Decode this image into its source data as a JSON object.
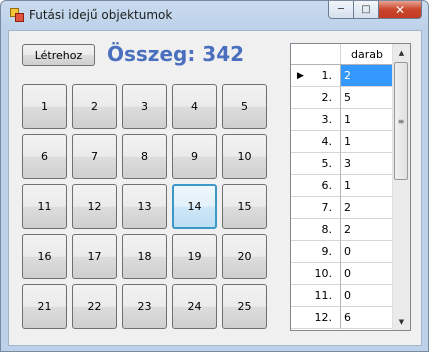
{
  "window": {
    "title": "Futási idejű objektumok",
    "min_glyph": "─",
    "max_glyph": "□",
    "close_glyph": "✕"
  },
  "toolbar": {
    "create_label": "Létrehoz"
  },
  "sum": {
    "text": "Összeg: 342"
  },
  "grid": {
    "buttons": [
      "1",
      "2",
      "3",
      "4",
      "5",
      "6",
      "7",
      "8",
      "9",
      "10",
      "11",
      "12",
      "13",
      "14",
      "15",
      "16",
      "17",
      "18",
      "19",
      "20",
      "21",
      "22",
      "23",
      "24",
      "25"
    ],
    "focused": "14"
  },
  "table": {
    "column": "darab",
    "current_row_marker": "▶",
    "rows": [
      {
        "index": "1.",
        "value": "2"
      },
      {
        "index": "2.",
        "value": "5"
      },
      {
        "index": "3.",
        "value": "1"
      },
      {
        "index": "4.",
        "value": "1"
      },
      {
        "index": "5.",
        "value": "3"
      },
      {
        "index": "6.",
        "value": "1"
      },
      {
        "index": "7.",
        "value": "2"
      },
      {
        "index": "8.",
        "value": "2"
      },
      {
        "index": "9.",
        "value": "0"
      },
      {
        "index": "10.",
        "value": "0"
      },
      {
        "index": "11.",
        "value": "0"
      },
      {
        "index": "12.",
        "value": "6"
      }
    ],
    "selected_row": 0
  },
  "scrollbar": {
    "up": "▲",
    "down": "▼",
    "grip": "≡"
  }
}
